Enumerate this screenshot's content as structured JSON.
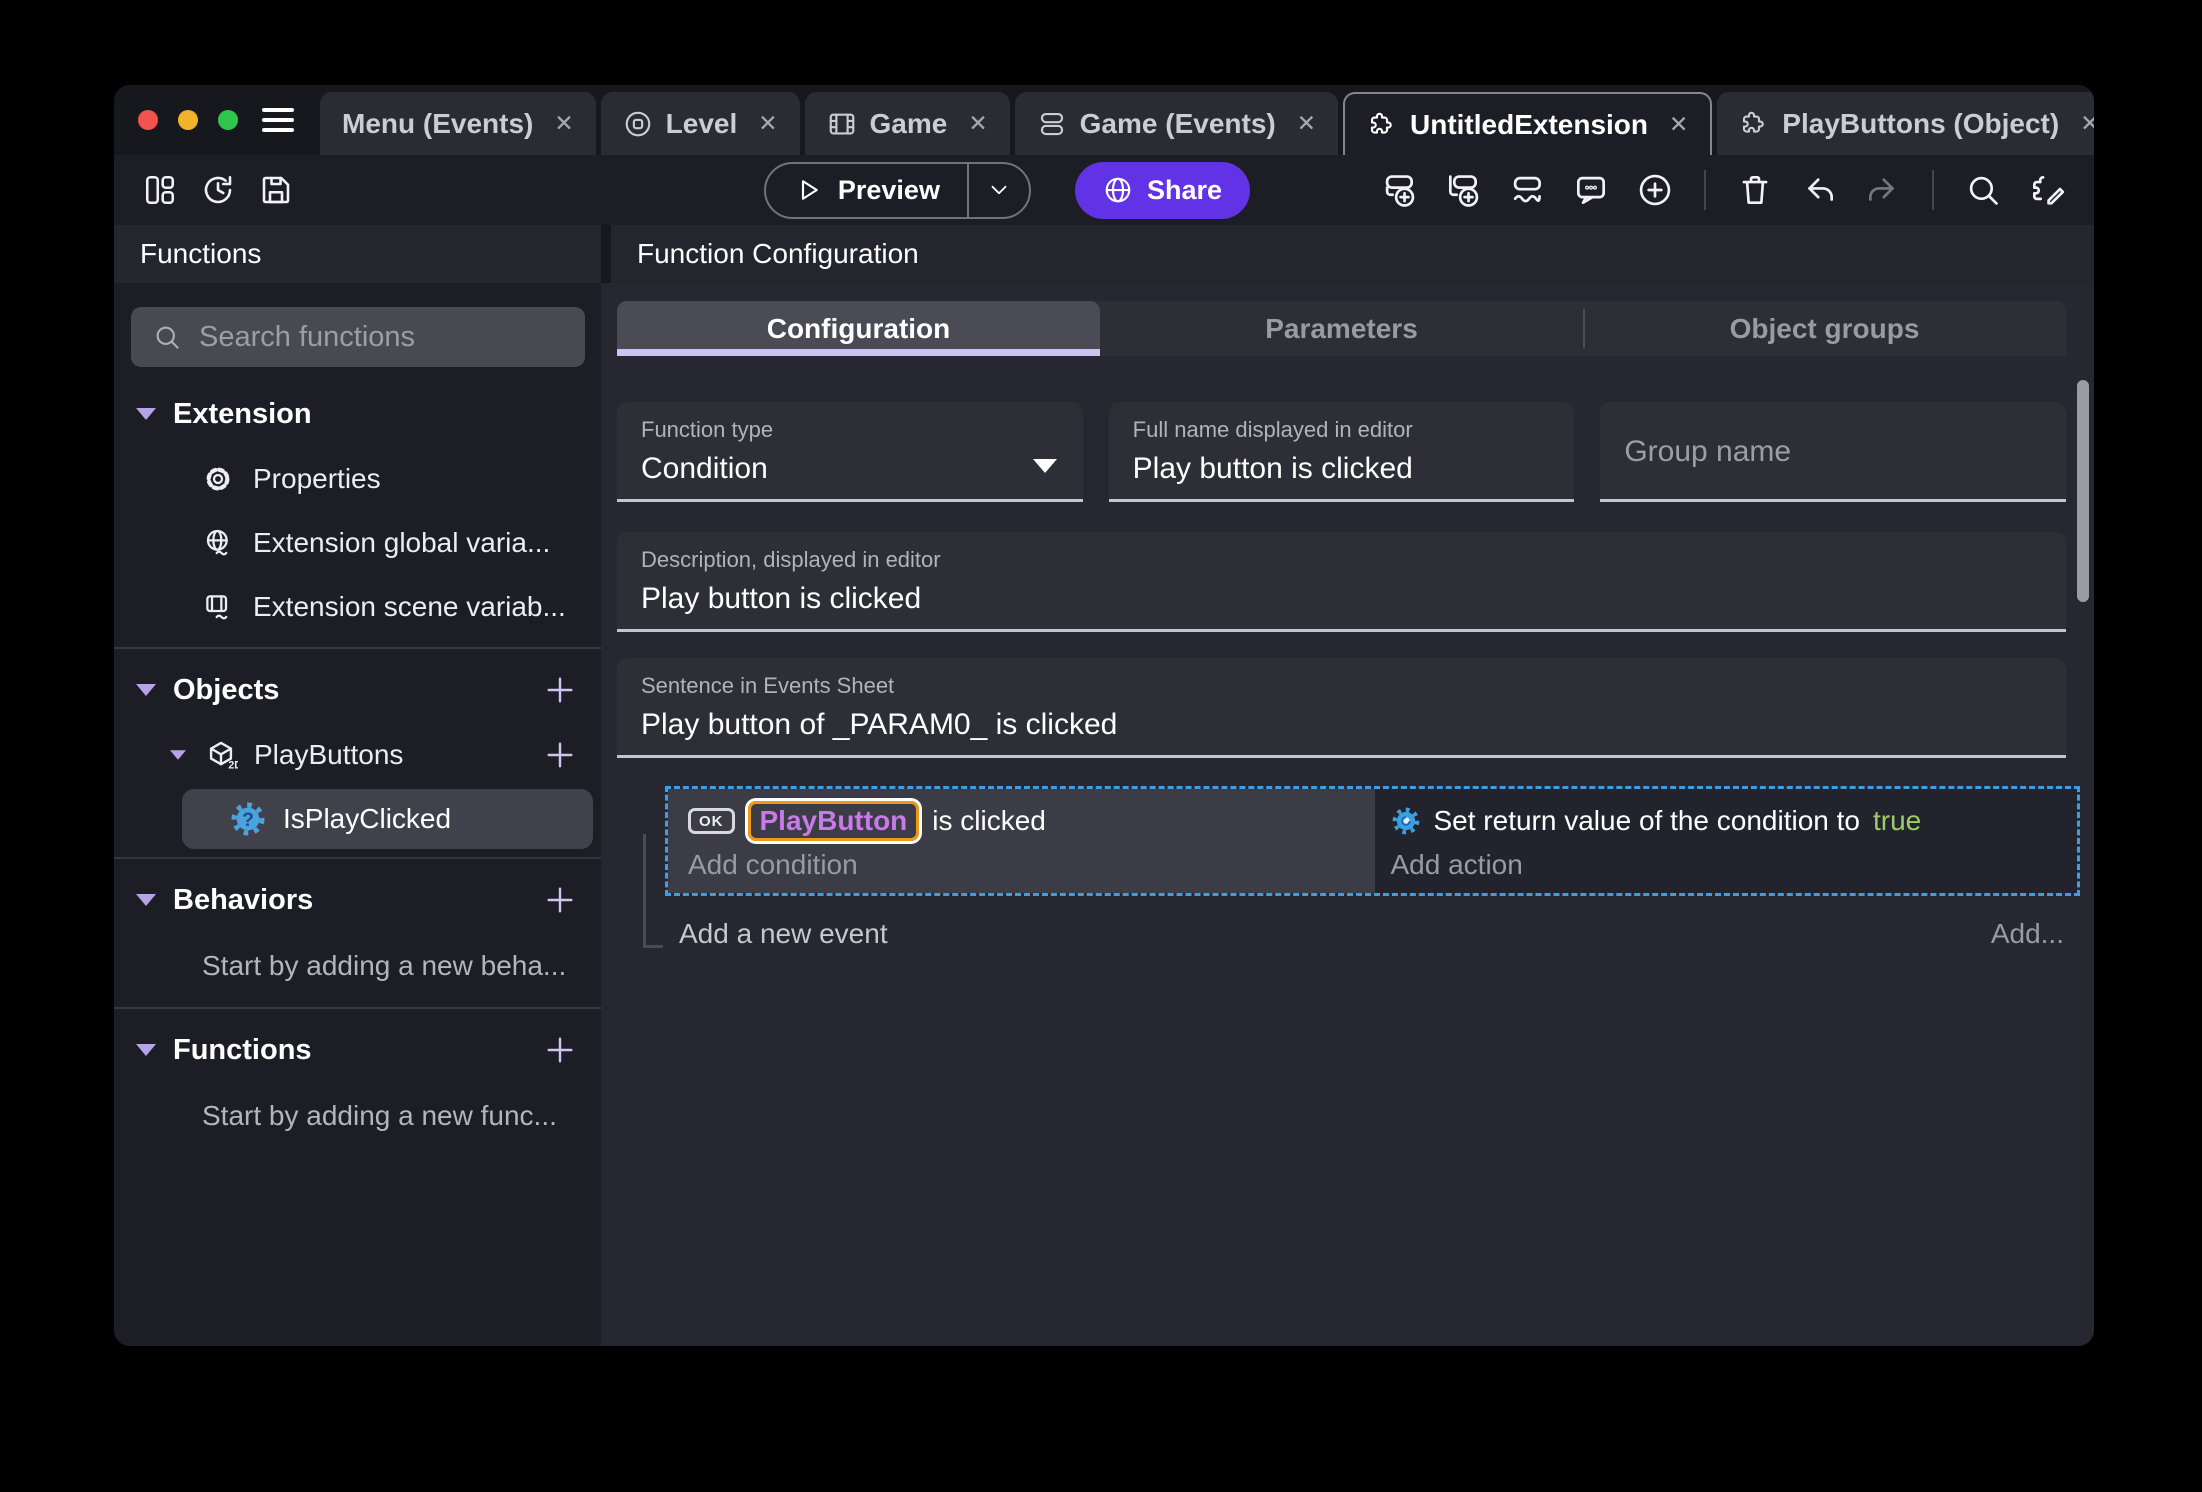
{
  "ui": {
    "close_glyph": "✕"
  },
  "titlebar": {
    "tabs": [
      {
        "label": "Menu (Events)"
      },
      {
        "label": "Level"
      },
      {
        "label": "Game"
      },
      {
        "label": "Game (Events)"
      },
      {
        "label": "UntitledExtension"
      },
      {
        "label": "PlayButtons (Object)"
      }
    ]
  },
  "toolbar": {
    "preview_label": "Preview",
    "share_label": "Share"
  },
  "sidebar": {
    "title": "Functions",
    "search_placeholder": "Search functions",
    "extension_section": {
      "label": "Extension",
      "items": [
        {
          "label": "Properties"
        },
        {
          "label": "Extension global varia..."
        },
        {
          "label": "Extension scene variab..."
        }
      ]
    },
    "objects_section": {
      "label": "Objects",
      "object": {
        "label": "PlayButtons"
      },
      "function": {
        "label": "IsPlayClicked"
      }
    },
    "behaviors_section": {
      "label": "Behaviors",
      "empty": "Start by adding a new beha..."
    },
    "functions_section": {
      "label": "Functions",
      "empty": "Start by adding a new func..."
    }
  },
  "main": {
    "title": "Function Configuration",
    "tabs": [
      {
        "label": "Configuration"
      },
      {
        "label": "Parameters"
      },
      {
        "label": "Object groups"
      }
    ],
    "fields": {
      "function_type": {
        "label": "Function type",
        "value": "Condition"
      },
      "full_name": {
        "label": "Full name displayed in editor",
        "value": "Play button is clicked"
      },
      "group_name": {
        "placeholder": "Group name"
      },
      "description": {
        "label": "Description, displayed in editor",
        "value": "Play button is clicked"
      },
      "sentence": {
        "label": "Sentence in Events Sheet",
        "value": "Play button of _PARAM0_ is clicked"
      }
    },
    "events": {
      "condition": {
        "badge": "OK",
        "object": "PlayButton",
        "text": "is clicked",
        "add_label": "Add condition"
      },
      "action": {
        "text": "Set return value of the condition to",
        "value": "true",
        "add_label": "Add action"
      },
      "add_new_event": "Add a new event",
      "add_more": "Add..."
    }
  },
  "icons": {
    "object_2d_badge": "2D"
  },
  "colors": {
    "accent_purple": "#6233e6",
    "lavender_accent": "#cdc3f2",
    "selection_blue": "#3d9ee8",
    "chip_border_orange": "#ea9a18",
    "chip_text_purple": "#c77ae8",
    "true_green": "#9ccc65",
    "function_icon_blue": "#4aa3dd"
  }
}
